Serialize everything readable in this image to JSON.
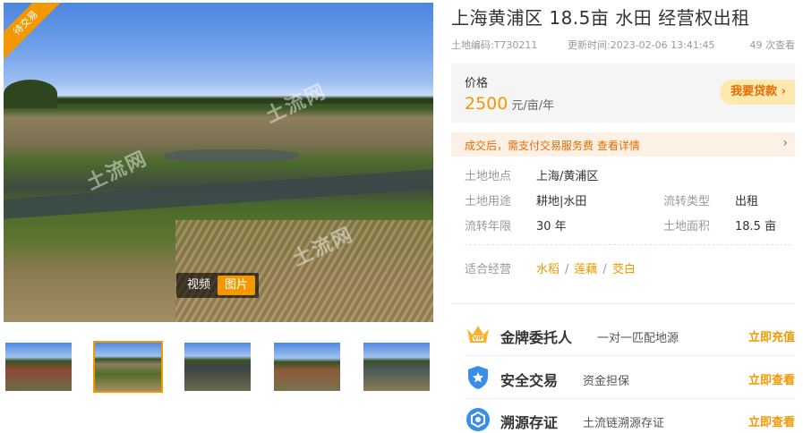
{
  "gallery": {
    "status_ribbon": "待交易",
    "watermark": "土流网",
    "media_tabs": [
      {
        "label": "视频",
        "active": false
      },
      {
        "label": "图片",
        "active": true
      }
    ],
    "thumbnails": [
      {
        "selected": false
      },
      {
        "selected": true
      },
      {
        "selected": false
      },
      {
        "selected": false
      },
      {
        "selected": false
      }
    ]
  },
  "listing": {
    "title": "上海黄浦区 18.5亩 水田 经营权出租",
    "code": "土地编码:T730211",
    "updated": "更新时间:2023-02-06 13:41:45",
    "views": "49 次查看"
  },
  "price": {
    "label": "价格",
    "value": "2500",
    "unit": "元/亩/年",
    "loan_button": "我要贷款 ›"
  },
  "fee_notice": {
    "text": "成交后，需支付交易服务费 查看详情",
    "chevron": "›"
  },
  "attributes": {
    "location_label": "土地地点",
    "location": "上海/黄浦区",
    "use_label": "土地用途",
    "use": "耕地|水田",
    "transfer_type_label": "流转类型",
    "transfer_type": "出租",
    "term_label": "流转年限",
    "term": "30 年",
    "area_label": "土地面积",
    "area": "18.5 亩"
  },
  "suited": {
    "label": "适合经营",
    "items": [
      "水稻",
      "莲藕",
      "茭白"
    ],
    "separator": "/"
  },
  "services": [
    {
      "icon": "crown-vip-icon",
      "name": "金牌委托人",
      "desc": "一对一匹配地源",
      "action": "立即充值"
    },
    {
      "icon": "shield-check-icon",
      "name": "安全交易",
      "desc": "资金担保",
      "action": "立即查看"
    },
    {
      "icon": "traceability-icon",
      "name": "溯源存证",
      "desc": "土流链溯源存证",
      "action": "立即查看"
    }
  ],
  "colors": {
    "accent": "#f39800",
    "price": "#f39800",
    "service_icon_blue": "#3a8ee6"
  }
}
